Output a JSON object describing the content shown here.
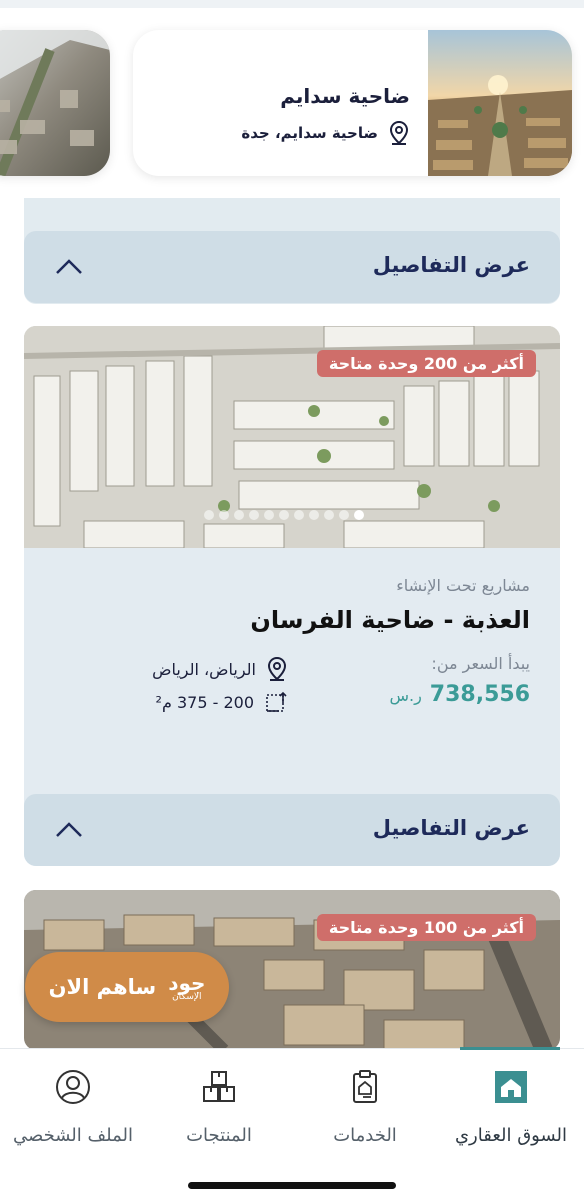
{
  "featured": {
    "title": "ضاحية سدايم",
    "location": "ضاحية سدايم، جدة"
  },
  "details_label": "عرض التفاصيل",
  "cards": [
    {
      "badge": "أكثر من 200 وحدة متاحة",
      "status": "مشاريع تحت الإنشاء",
      "name": "العذبة - ضاحية الفرسان",
      "price_label": "يبدأ السعر من:",
      "price": "738,556",
      "currency": "ر.س",
      "location": "الرياض، الرياض",
      "area": "200 - 375 م²"
    },
    {
      "badge": "أكثر من 100 وحدة متاحة"
    }
  ],
  "fab": {
    "label": "ساهم الان",
    "logo_main": "جود",
    "logo_sub": "الإسكان"
  },
  "nav": {
    "items": [
      {
        "label": "السوق العقاري",
        "icon": "home-icon",
        "active": true
      },
      {
        "label": "الخدمات",
        "icon": "clipboard-icon",
        "active": false
      },
      {
        "label": "المنتجات",
        "icon": "boxes-icon",
        "active": false
      },
      {
        "label": "الملف الشخصي",
        "icon": "user-icon",
        "active": false
      }
    ]
  },
  "colors": {
    "accent": "#3b8f91",
    "price": "#3b9b97",
    "badge": "#cf6e6a",
    "fab": "#d08b48",
    "card_bg": "#e3ebf1",
    "details_bg": "#cfdde6"
  }
}
